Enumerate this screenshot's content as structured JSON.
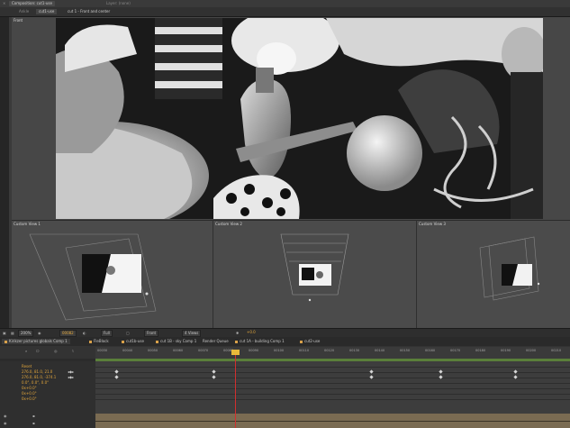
{
  "window": {
    "tab_label": "Composition: cut1-use",
    "layer_label": "Layer: (none)",
    "crumb_render": "Ankle",
    "crumb_comp": "cut1-use",
    "crumb_camera": "cut 1 - Front and center"
  },
  "viewer": {
    "active_view": "Front"
  },
  "custom_views": [
    {
      "label": "Custom View 1"
    },
    {
      "label": "Custom View 2"
    },
    {
      "label": "Custom View 3"
    }
  ],
  "viewer_footer": {
    "zoom": "200%",
    "timecode": "00082",
    "resolution": "Full",
    "view": "Front",
    "layout": "4 Views",
    "exposure": "+0.0"
  },
  "timeline_tabs": [
    "Kirikzer pictures globals Comp 1",
    "FleBlock",
    "cut1b-use",
    "cut 1B - sky Comp 1",
    "Render Queue",
    "cut 1A - building Comp 1",
    "cut2-use"
  ],
  "ruler_ticks": [
    "00030",
    "00040",
    "00050",
    "00060",
    "00070",
    "00080",
    "00090",
    "00100",
    "00110",
    "00120",
    "00130",
    "00140",
    "00150",
    "00160",
    "00170",
    "00180",
    "00190",
    "00200",
    "00210"
  ],
  "properties": [
    "Reset",
    "276.0, 81.0, 21.0",
    "276.0, 81.0, -374.1",
    "0.0°, 0.0°, 0.0°",
    "0x+0.0°",
    "0x+0.0°",
    "0x+0.0°"
  ],
  "colors": {
    "accent": "#e2a63b",
    "cti": "#d12f2f",
    "workarea": "#5a7f3a",
    "bottom_bar": "#7a6b52"
  }
}
